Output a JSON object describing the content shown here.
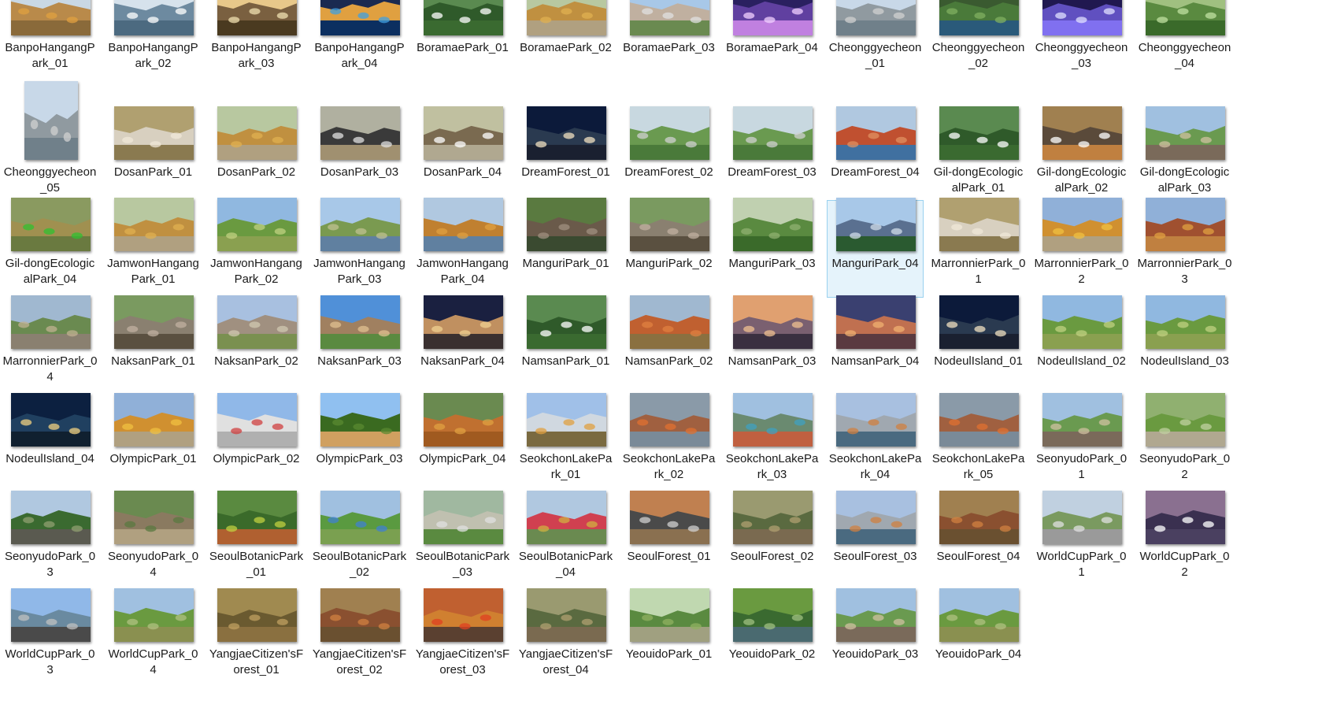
{
  "explorer": {
    "view": "large-icons",
    "selected_index": 32,
    "items": [
      {
        "name": "BanpoHangangPark_01",
        "thumb": "autumn-park"
      },
      {
        "name": "BanpoHangangPark_02",
        "thumb": "river-day"
      },
      {
        "name": "BanpoHangangPark_03",
        "thumb": "sunset-reeds"
      },
      {
        "name": "BanpoHangangPark_04",
        "thumb": "night-bridge"
      },
      {
        "name": "BoramaePark_01",
        "thumb": "park-sign"
      },
      {
        "name": "BoramaePark_02",
        "thumb": "autumn-path"
      },
      {
        "name": "BoramaePark_03",
        "thumb": "monument"
      },
      {
        "name": "BoramaePark_04",
        "thumb": "night-flowers"
      },
      {
        "name": "Cheonggyecheon_01",
        "thumb": "stream-city"
      },
      {
        "name": "Cheonggyecheon_02",
        "thumb": "stream-green"
      },
      {
        "name": "Cheonggyecheon_03",
        "thumb": "night-fountain"
      },
      {
        "name": "Cheonggyecheon_04",
        "thumb": "greenery"
      },
      {
        "name": "Cheonggyecheon_05",
        "thumb": "stream-city",
        "portrait": true
      },
      {
        "name": "DosanPark_01",
        "thumb": "stone-monument"
      },
      {
        "name": "DosanPark_02",
        "thumb": "autumn-path"
      },
      {
        "name": "DosanPark_03",
        "thumb": "signboard"
      },
      {
        "name": "DosanPark_04",
        "thumb": "trees-sign"
      },
      {
        "name": "DreamForest_01",
        "thumb": "night-sign"
      },
      {
        "name": "DreamForest_02",
        "thumb": "green-aerial"
      },
      {
        "name": "DreamForest_03",
        "thumb": "green-aerial"
      },
      {
        "name": "DreamForest_04",
        "thumb": "autumn-pond"
      },
      {
        "name": "Gil-dongEcologicalPark_01",
        "thumb": "park-sign"
      },
      {
        "name": "Gil-dongEcologicalPark_02",
        "thumb": "autumn-sign"
      },
      {
        "name": "Gil-dongEcologicalPark_03",
        "thumb": "boardwalk"
      },
      {
        "name": "Gil-dongEcologicalPark_04",
        "thumb": "scarecrow"
      },
      {
        "name": "JamwonHangangPark_01",
        "thumb": "autumn-path"
      },
      {
        "name": "JamwonHangangPark_02",
        "thumb": "green-field"
      },
      {
        "name": "JamwonHangangPark_03",
        "thumb": "trees-river"
      },
      {
        "name": "JamwonHangangPark_04",
        "thumb": "autumn-river"
      },
      {
        "name": "ManguriPark_01",
        "thumb": "forest-stairs"
      },
      {
        "name": "ManguriPark_02",
        "thumb": "stone-wall"
      },
      {
        "name": "ManguriPark_03",
        "thumb": "forest"
      },
      {
        "name": "ManguriPark_04",
        "thumb": "mountain-city"
      },
      {
        "name": "MarronnierPark_01",
        "thumb": "stone-monument"
      },
      {
        "name": "MarronnierPark_02",
        "thumb": "autumn-plaza"
      },
      {
        "name": "MarronnierPark_03",
        "thumb": "brick-building"
      },
      {
        "name": "MarronnierPark_04",
        "thumb": "stream-rocks"
      },
      {
        "name": "NaksanPark_01",
        "thumb": "stone-wall"
      },
      {
        "name": "NaksanPark_02",
        "thumb": "city-hill"
      },
      {
        "name": "NaksanPark_03",
        "thumb": "fortress-wall"
      },
      {
        "name": "NaksanPark_04",
        "thumb": "night-pavilion"
      },
      {
        "name": "NamsanPark_01",
        "thumb": "park-sign"
      },
      {
        "name": "NamsanPark_02",
        "thumb": "autumn-flowers"
      },
      {
        "name": "NamsanPark_03",
        "thumb": "tower-sunset"
      },
      {
        "name": "NamsanPark_04",
        "thumb": "night-city"
      },
      {
        "name": "NodeulIsland_01",
        "thumb": "night-sign"
      },
      {
        "name": "NodeulIsland_02",
        "thumb": "green-field"
      },
      {
        "name": "NodeulIsland_03",
        "thumb": "green-field"
      },
      {
        "name": "NodeulIsland_04",
        "thumb": "night-sphere"
      },
      {
        "name": "OlympicPark_01",
        "thumb": "autumn-plaza"
      },
      {
        "name": "OlympicPark_02",
        "thumb": "gate"
      },
      {
        "name": "OlympicPark_03",
        "thumb": "lone-tree"
      },
      {
        "name": "OlympicPark_04",
        "thumb": "flower-field"
      },
      {
        "name": "SeokchonLakePark_01",
        "thumb": "tower"
      },
      {
        "name": "SeokchonLakePark_02",
        "thumb": "lake-autumn"
      },
      {
        "name": "SeokchonLakePark_03",
        "thumb": "aerial-tower"
      },
      {
        "name": "SeokchonLakePark_04",
        "thumb": "lake-city"
      },
      {
        "name": "SeokchonLakePark_05",
        "thumb": "lake-autumn"
      },
      {
        "name": "SeonyudoPark_01",
        "thumb": "boardwalk"
      },
      {
        "name": "SeonyudoPark_02",
        "thumb": "bamboo-path"
      },
      {
        "name": "SeonyudoPark_03",
        "thumb": "garden-building"
      },
      {
        "name": "SeonyudoPark_04",
        "thumb": "garden-path"
      },
      {
        "name": "SeoulBotanicPark_01",
        "thumb": "botanic-wall"
      },
      {
        "name": "SeoulBotanicPark_02",
        "thumb": "garden-globe"
      },
      {
        "name": "SeoulBotanicPark_03",
        "thumb": "garden-stairs"
      },
      {
        "name": "SeoulBotanicPark_04",
        "thumb": "botanic-sign"
      },
      {
        "name": "SeoulForest_01",
        "thumb": "forest-monument"
      },
      {
        "name": "SeoulForest_02",
        "thumb": "forest-path"
      },
      {
        "name": "SeoulForest_03",
        "thumb": "lake-city"
      },
      {
        "name": "SeoulForest_04",
        "thumb": "autumn-forest"
      },
      {
        "name": "WorldCupPark_01",
        "thumb": "walkway"
      },
      {
        "name": "WorldCupPark_02",
        "thumb": "seoul-sign"
      },
      {
        "name": "WorldCupPark_03",
        "thumb": "river-walk"
      },
      {
        "name": "WorldCupPark_04",
        "thumb": "willow"
      },
      {
        "name": "YangjaeCitizen'sForest_01",
        "thumb": "pine-forest"
      },
      {
        "name": "YangjaeCitizen'sForest_02",
        "thumb": "autumn-forest"
      },
      {
        "name": "YangjaeCitizen'sForest_03",
        "thumb": "red-maple"
      },
      {
        "name": "YangjaeCitizen'sForest_04",
        "thumb": "forest-path"
      },
      {
        "name": "YeouidoPark_01",
        "thumb": "green-trees"
      },
      {
        "name": "YeouidoPark_02",
        "thumb": "pond-trees"
      },
      {
        "name": "YeouidoPark_03",
        "thumb": "boardwalk"
      },
      {
        "name": "YeouidoPark_04",
        "thumb": "willow"
      }
    ]
  },
  "thumb_styles": {
    "autumn-park": {
      "sky": "#c9d8e4",
      "mid": "#b98a4a",
      "ground": "#8a6a3a",
      "accent": "#e0a040"
    },
    "river-day": {
      "sky": "#d6e2ec",
      "mid": "#6d8aa0",
      "ground": "#4c6a80",
      "accent": "#ffffff"
    },
    "sunset-reeds": {
      "sky": "#e8c88a",
      "mid": "#7a6040",
      "ground": "#4a3a20",
      "accent": "#f0e0b0"
    },
    "night-bridge": {
      "sky": "#1a2a50",
      "mid": "#e0a040",
      "ground": "#0c2f60",
      "accent": "#40a0e0"
    },
    "park-sign": {
      "sky": "#5a8a50",
      "mid": "#2f5a2a",
      "ground": "#3a6a30",
      "accent": "#ffffff"
    },
    "autumn-path": {
      "sky": "#b8c8a0",
      "mid": "#c09040",
      "ground": "#b0a080",
      "accent": "#e0b050"
    },
    "monument": {
      "sky": "#a8c8e8",
      "mid": "#c0b0a0",
      "ground": "#6a8a50",
      "accent": "#e0e0e0"
    },
    "night-flowers": {
      "sky": "#2a2060",
      "mid": "#6040a0",
      "ground": "#c080e0",
      "accent": "#f0d0ff"
    },
    "stream-city": {
      "sky": "#c8d8e8",
      "mid": "#909aa0",
      "ground": "#70808a",
      "accent": "#d0d0d0"
    },
    "stream-green": {
      "sky": "#3a5a30",
      "mid": "#4a7a3a",
      "ground": "#2a5a7a",
      "accent": "#80b060"
    },
    "night-fountain": {
      "sky": "#201850",
      "mid": "#6050c0",
      "ground": "#8070f0",
      "accent": "#e0e0ff"
    },
    "greenery": {
      "sky": "#a0c080",
      "mid": "#5a8a40",
      "ground": "#3a6a2a",
      "accent": "#c0e0a0"
    },
    "stone-monument": {
      "sky": "#b0a070",
      "mid": "#d8d0c0",
      "ground": "#8a7a50",
      "accent": "#f0e8d8"
    },
    "signboard": {
      "sky": "#b0b0a0",
      "mid": "#3a3a3a",
      "ground": "#a09070",
      "accent": "#e0e0e0"
    },
    "trees-sign": {
      "sky": "#c0c0a0",
      "mid": "#7a6a50",
      "ground": "#b0a890",
      "accent": "#ffffff"
    },
    "night-sign": {
      "sky": "#0c1a3a",
      "mid": "#2a3a50",
      "ground": "#1a2030",
      "accent": "#f0e0c0"
    },
    "green-aerial": {
      "sky": "#c8d8e0",
      "mid": "#6a9a50",
      "ground": "#4a7a3a",
      "accent": "#d0d0d0"
    },
    "autumn-pond": {
      "sky": "#b0c8e0",
      "mid": "#c05030",
      "ground": "#4070a0",
      "accent": "#e09060"
    },
    "autumn-sign": {
      "sky": "#a08050",
      "mid": "#5a4a3a",
      "ground": "#c08040",
      "accent": "#ffffff"
    },
    "boardwalk": {
      "sky": "#a0c0e0",
      "mid": "#6a9a50",
      "ground": "#7a6a5a",
      "accent": "#d0c0a0"
    },
    "scarecrow": {
      "sky": "#8a9a60",
      "mid": "#a09050",
      "ground": "#6a7a40",
      "accent": "#30c030"
    },
    "green-field": {
      "sky": "#90b8e0",
      "mid": "#6a9a40",
      "ground": "#8aa050",
      "accent": "#c0d080"
    },
    "trees-river": {
      "sky": "#a8c8e8",
      "mid": "#7a9a50",
      "ground": "#6080a0",
      "accent": "#c0c090"
    },
    "autumn-river": {
      "sky": "#b0c8e0",
      "mid": "#c08030",
      "ground": "#6080a0",
      "accent": "#e0a040"
    },
    "forest-stairs": {
      "sky": "#5a7a40",
      "mid": "#6a5a4a",
      "ground": "#3a4a30",
      "accent": "#a09080"
    },
    "stone-wall": {
      "sky": "#7a9a60",
      "mid": "#8a8070",
      "ground": "#5a5040",
      "accent": "#c0b0a0"
    },
    "forest": {
      "sky": "#c0d0b0",
      "mid": "#5a8a40",
      "ground": "#3a6a2a",
      "accent": "#90b070"
    },
    "mountain-city": {
      "sky": "#a8c8e8",
      "mid": "#5a7090",
      "ground": "#2a5a30",
      "accent": "#d0dce8"
    },
    "autumn-plaza": {
      "sky": "#90b0d8",
      "mid": "#d09030",
      "ground": "#b0a080",
      "accent": "#f0c040"
    },
    "brick-building": {
      "sky": "#90b0d8",
      "mid": "#a05030",
      "ground": "#c08040",
      "accent": "#e0a040"
    },
    "stream-rocks": {
      "sky": "#a0b8d0",
      "mid": "#6a8a50",
      "ground": "#8a8070",
      "accent": "#c0b090"
    },
    "city-hill": {
      "sky": "#a8c0e0",
      "mid": "#a09080",
      "ground": "#7a9050",
      "accent": "#d0c8b0"
    },
    "fortress-wall": {
      "sky": "#5090d8",
      "mid": "#a08060",
      "ground": "#5a8a40",
      "accent": "#e0c090"
    },
    "night-pavilion": {
      "sky": "#1a2040",
      "mid": "#c09060",
      "ground": "#3a3030",
      "accent": "#f0d090"
    },
    "autumn-flowers": {
      "sky": "#a0b8d0",
      "mid": "#c06030",
      "ground": "#8a7040",
      "accent": "#e08040"
    },
    "tower-sunset": {
      "sky": "#e0a070",
      "mid": "#7a6070",
      "ground": "#3a3040",
      "accent": "#f0c090"
    },
    "night-city": {
      "sky": "#3a4070",
      "mid": "#c07050",
      "ground": "#5a3a40",
      "accent": "#f0b070"
    },
    "night-sphere": {
      "sky": "#0c2040",
      "mid": "#204060",
      "ground": "#102030",
      "accent": "#f0d080"
    },
    "gate": {
      "sky": "#90b8e8",
      "mid": "#e0e0e0",
      "ground": "#b0b0b0",
      "accent": "#d04040"
    },
    "lone-tree": {
      "sky": "#90c0f0",
      "mid": "#3a6a20",
      "ground": "#d0a060",
      "accent": "#5a8a30"
    },
    "flower-field": {
      "sky": "#6a8a50",
      "mid": "#c07030",
      "ground": "#a05a20",
      "accent": "#e0a040"
    },
    "tower": {
      "sky": "#a0c0e8",
      "mid": "#d0d8e0",
      "ground": "#7a6a40",
      "accent": "#e0a040"
    },
    "lake-autumn": {
      "sky": "#8a9aa8",
      "mid": "#a06040",
      "ground": "#7a8a98",
      "accent": "#e07030"
    },
    "aerial-tower": {
      "sky": "#a0c0e0",
      "mid": "#6a8a70",
      "ground": "#c06040",
      "accent": "#40a0c0"
    },
    "lake-city": {
      "sky": "#a8c0e0",
      "mid": "#a0a8b0",
      "ground": "#4a6a80",
      "accent": "#d08040"
    },
    "bamboo-path": {
      "sky": "#90b070",
      "mid": "#6a9a40",
      "ground": "#b0a890",
      "accent": "#c0d0a0"
    },
    "garden-building": {
      "sky": "#b0c8e0",
      "mid": "#3a6a30",
      "ground": "#5a5a50",
      "accent": "#90a070"
    },
    "garden-path": {
      "sky": "#6a8a50",
      "mid": "#8a7a60",
      "ground": "#b0a080",
      "accent": "#5a7a40"
    },
    "botanic-wall": {
      "sky": "#5a8a40",
      "mid": "#3a6a2a",
      "ground": "#b06030",
      "accent": "#c0d040"
    },
    "garden-globe": {
      "sky": "#a0c0e0",
      "mid": "#5a9a40",
      "ground": "#7aa050",
      "accent": "#4080d0"
    },
    "garden-stairs": {
      "sky": "#a0b8a0",
      "mid": "#c0c0b0",
      "ground": "#5a8a40",
      "accent": "#e0e0e0"
    },
    "botanic-sign": {
      "sky": "#b0c8e0",
      "mid": "#d04050",
      "ground": "#6a8a50",
      "accent": "#d0b040"
    },
    "forest-monument": {
      "sky": "#c08050",
      "mid": "#4a4a4a",
      "ground": "#8a7050",
      "accent": "#d0d0d0"
    },
    "forest-path": {
      "sky": "#9a9a70",
      "mid": "#5a6a40",
      "ground": "#7a6a50",
      "accent": "#b0a070"
    },
    "autumn-forest": {
      "sky": "#a08050",
      "mid": "#8a5030",
      "ground": "#6a5030",
      "accent": "#d08040"
    },
    "walkway": {
      "sky": "#c0d0e0",
      "mid": "#7a9a60",
      "ground": "#9a9a9a",
      "accent": "#e0e0e0"
    },
    "seoul-sign": {
      "sky": "#8a7090",
      "mid": "#3a3050",
      "ground": "#4a4060",
      "accent": "#ffffff"
    },
    "river-walk": {
      "sky": "#90b8e8",
      "mid": "#6a8aa0",
      "ground": "#4a4a4a",
      "accent": "#c0c0c0"
    },
    "willow": {
      "sky": "#a0c0e0",
      "mid": "#6a9a40",
      "ground": "#8a9050",
      "accent": "#b0c080"
    },
    "pine-forest": {
      "sky": "#a08a50",
      "mid": "#6a5a30",
      "ground": "#8a7040",
      "accent": "#c0a060"
    },
    "red-maple": {
      "sky": "#c06030",
      "mid": "#d08030",
      "ground": "#5a4030",
      "accent": "#e04020"
    },
    "green-trees": {
      "sky": "#c0d8b0",
      "mid": "#5a8a40",
      "ground": "#a0a080",
      "accent": "#90b060"
    },
    "pond-trees": {
      "sky": "#6a9a40",
      "mid": "#3a6a30",
      "ground": "#4a6a70",
      "accent": "#a0c080"
    }
  }
}
